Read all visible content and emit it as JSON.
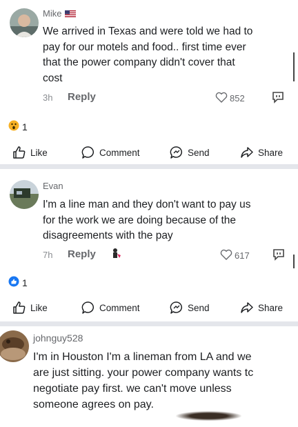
{
  "comments": [
    {
      "author": "Mike",
      "author_suffix_icon": "us-flag-icon",
      "text": "We arrived in Texas and were told we had to\npay for our motels and food.. first time ever\nthat the power company didn't cover that\ncost",
      "time": "3h",
      "reply_label": "Reply",
      "like_count": "852",
      "reaction_count": "1",
      "reaction_icon": "wow-icon"
    },
    {
      "author": "Evan",
      "text": "I'm a line man and they don't want to pay us\nfor the work we are doing because of the\ndisagreements with the pay",
      "time": "7h",
      "reply_label": "Reply",
      "like_count": "617",
      "reaction_count": "1",
      "reaction_icon": "like-reaction-icon"
    },
    {
      "author": "johnguy528",
      "text": "I'm in Houston I'm a lineman from LA and we\nare just sitting. your power company wants tc\nnegotiate pay first. we can't move unless\nsomeone agrees on pay."
    }
  ],
  "actions": {
    "like": "Like",
    "comment": "Comment",
    "send": "Send",
    "share": "Share"
  },
  "colors": {
    "like_reaction_blue": "#1877f2",
    "wow_yellow": "#f7b125",
    "divider": "#e4e6eb",
    "muted_text": "#65676b"
  }
}
